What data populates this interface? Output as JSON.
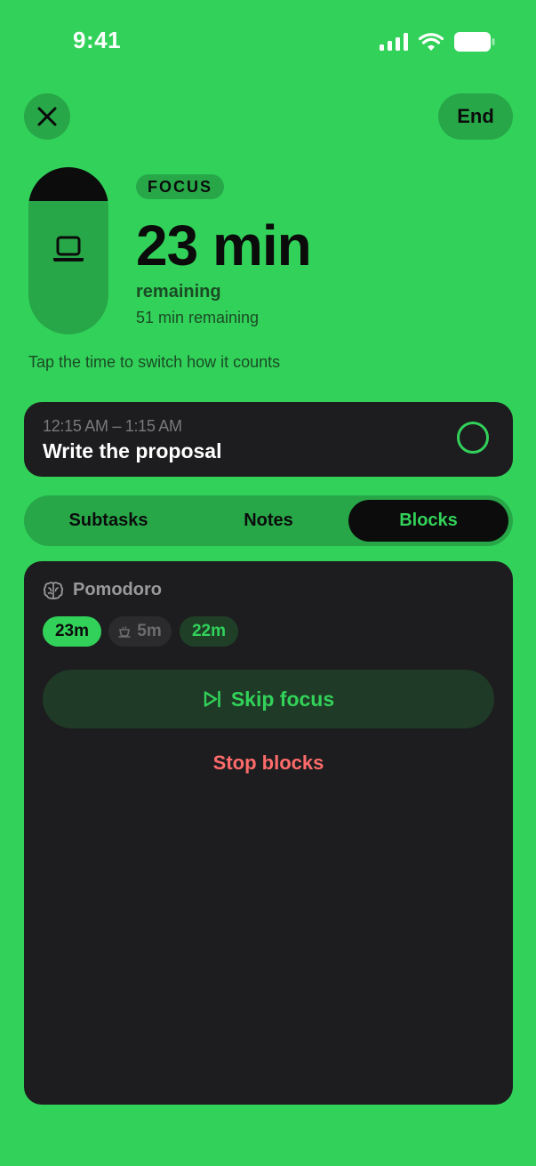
{
  "status_bar": {
    "time": "9:41"
  },
  "header": {
    "end_label": "End"
  },
  "timer": {
    "mode_badge": "FOCUS",
    "time_display": "23 min",
    "remaining_label": "remaining",
    "secondary_remaining": "51 min remaining",
    "hint": "Tap the time to switch how it counts",
    "elapsed_fraction": 0.2,
    "icon": "laptop-icon"
  },
  "task": {
    "time_range": "12:15 AM – 1:15 AM",
    "title": "Write the proposal"
  },
  "tabs": [
    {
      "label": "Subtasks",
      "active": false
    },
    {
      "label": "Notes",
      "active": false
    },
    {
      "label": "Blocks",
      "active": true
    }
  ],
  "blocks": {
    "title": "Pomodoro",
    "icon": "brain-icon",
    "chips": [
      {
        "label": "23m",
        "state": "active"
      },
      {
        "label": "5m",
        "state": "break",
        "icon": "coffee-icon"
      },
      {
        "label": "22m",
        "state": "upcoming"
      }
    ],
    "skip_label": "Skip focus",
    "skip_icon": "skip-forward-icon",
    "stop_label": "Stop blocks"
  },
  "colors": {
    "background": "#32d25a",
    "accent": "#32d25a",
    "card": "#1d1d1f",
    "danger": "#ff6b6b"
  }
}
